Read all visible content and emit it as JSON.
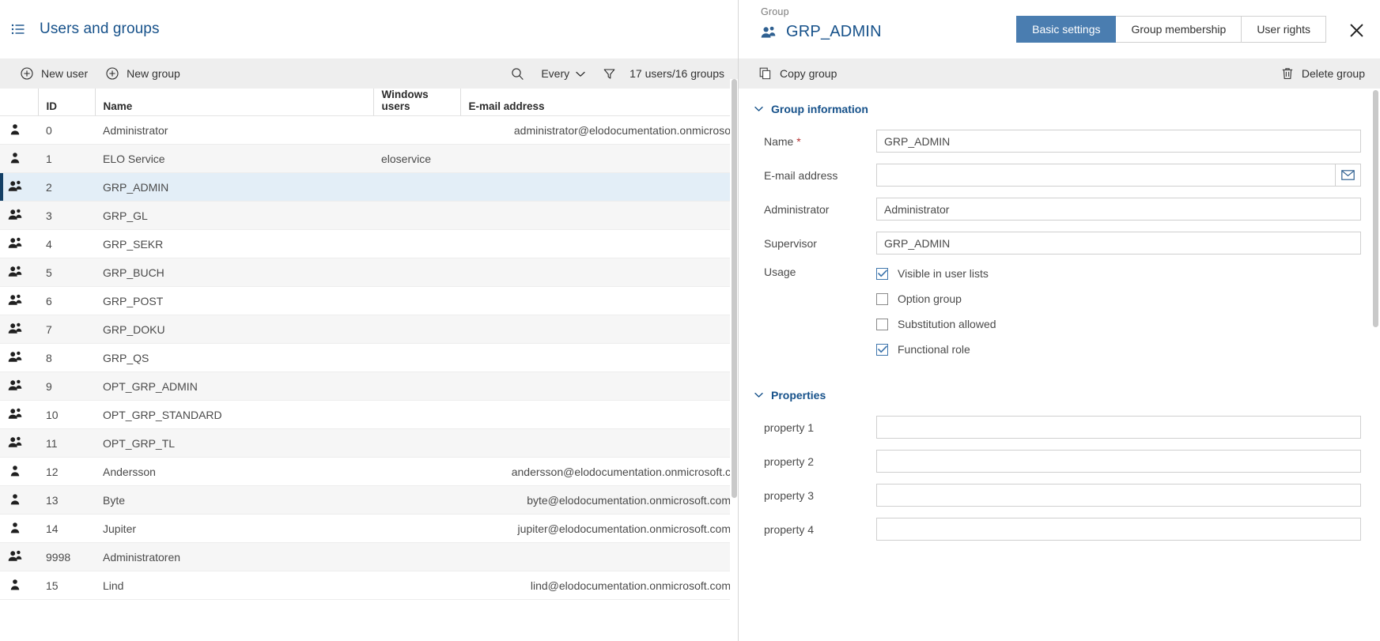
{
  "left": {
    "header": {
      "title": "Users and groups",
      "menu_icon": "list-icon"
    },
    "toolbar": {
      "new_user": "New user",
      "new_group": "New group",
      "search_icon": "search-icon",
      "filter_select": "Every",
      "filter_icon": "funnel-icon",
      "count": "17 users/16 groups"
    },
    "columns": [
      "",
      "ID",
      "Name",
      "Windows users",
      "E-mail address"
    ],
    "rows": [
      {
        "type": "user",
        "id": "0",
        "name": "Administrator",
        "windows": "",
        "email": "administrator@elodocumentation.onmicroso"
      },
      {
        "type": "user",
        "id": "1",
        "name": "ELO Service",
        "windows": "eloservice",
        "email": ""
      },
      {
        "type": "group",
        "id": "2",
        "name": "GRP_ADMIN",
        "windows": "",
        "email": ""
      },
      {
        "type": "group",
        "id": "3",
        "name": "GRP_GL",
        "windows": "",
        "email": ""
      },
      {
        "type": "group",
        "id": "4",
        "name": "GRP_SEKR",
        "windows": "",
        "email": ""
      },
      {
        "type": "group",
        "id": "5",
        "name": "GRP_BUCH",
        "windows": "",
        "email": ""
      },
      {
        "type": "group",
        "id": "6",
        "name": "GRP_POST",
        "windows": "",
        "email": ""
      },
      {
        "type": "group",
        "id": "7",
        "name": "GRP_DOKU",
        "windows": "",
        "email": ""
      },
      {
        "type": "group",
        "id": "8",
        "name": "GRP_QS",
        "windows": "",
        "email": ""
      },
      {
        "type": "group",
        "id": "9",
        "name": "OPT_GRP_ADMIN",
        "windows": "",
        "email": ""
      },
      {
        "type": "group",
        "id": "10",
        "name": "OPT_GRP_STANDARD",
        "windows": "",
        "email": ""
      },
      {
        "type": "group",
        "id": "11",
        "name": "OPT_GRP_TL",
        "windows": "",
        "email": ""
      },
      {
        "type": "user",
        "id": "12",
        "name": "Andersson",
        "windows": "",
        "email": "andersson@elodocumentation.onmicrosoft.c"
      },
      {
        "type": "user",
        "id": "13",
        "name": "Byte",
        "windows": "",
        "email": "byte@elodocumentation.onmicrosoft.com"
      },
      {
        "type": "user",
        "id": "14",
        "name": "Jupiter",
        "windows": "",
        "email": "jupiter@elodocumentation.onmicrosoft.com"
      },
      {
        "type": "group",
        "id": "9998",
        "name": "Administratoren",
        "windows": "",
        "email": ""
      },
      {
        "type": "user",
        "id": "15",
        "name": "Lind",
        "windows": "",
        "email": "lind@elodocumentation.onmicrosoft.com"
      }
    ],
    "selected_row_index": 2
  },
  "right": {
    "kicker": "Group",
    "title": "GRP_ADMIN",
    "group_icon": "group-icon",
    "tabs": [
      {
        "label": "Basic settings",
        "active": true
      },
      {
        "label": "Group membership",
        "active": false
      },
      {
        "label": "User rights",
        "active": false
      }
    ],
    "close_icon": "close-icon",
    "toolbar": {
      "copy_group": "Copy group",
      "copy_icon": "copy-icon",
      "delete_group": "Delete group",
      "delete_icon": "trash-icon"
    },
    "group_information": {
      "section_title": "Group information",
      "fields": [
        {
          "label": "Name",
          "required": true,
          "value": "GRP_ADMIN"
        },
        {
          "label": "E-mail address",
          "required": false,
          "value": "",
          "button_icon": "envelope-icon"
        },
        {
          "label": "Administrator",
          "required": false,
          "value": "Administrator"
        },
        {
          "label": "Supervisor",
          "required": false,
          "value": "GRP_ADMIN"
        }
      ],
      "usage_label": "Usage",
      "usage_options": [
        {
          "label": "Visible in user lists",
          "checked": true
        },
        {
          "label": "Option group",
          "checked": false
        },
        {
          "label": "Substitution allowed",
          "checked": false
        },
        {
          "label": "Functional role",
          "checked": true
        }
      ]
    },
    "properties": {
      "section_title": "Properties",
      "fields": [
        {
          "label": "property 1",
          "value": ""
        },
        {
          "label": "property 2",
          "value": ""
        },
        {
          "label": "property 3",
          "value": ""
        },
        {
          "label": "property 4",
          "value": ""
        }
      ]
    }
  },
  "colors": {
    "accent": "#16518a",
    "tab_active": "#4a7db0",
    "selection": "#e3eef7",
    "selection_bar": "#123f66",
    "toolbar_bg": "#eeeeee"
  }
}
